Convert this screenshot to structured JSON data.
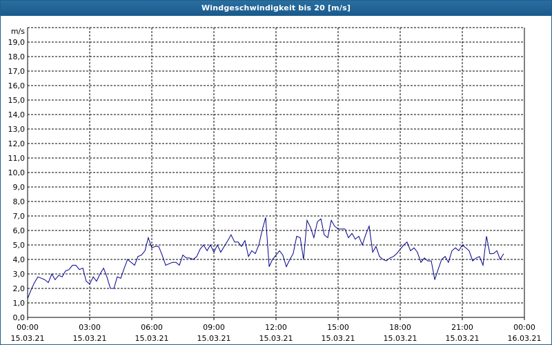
{
  "window": {
    "title": "Windgeschwindigkeit bis 20 [m/s]"
  },
  "colors": {
    "title_bar": "#1f5f8f",
    "series": "#00008b",
    "grid": "#000000"
  },
  "chart_data": {
    "type": "line",
    "title": "Windgeschwindigkeit bis 20 [m/s]",
    "ylabel": "m/s",
    "ylim": [
      0,
      20
    ],
    "y_ticks": [
      "0,0",
      "1,0",
      "2,0",
      "3,0",
      "4,0",
      "5,0",
      "6,0",
      "7,0",
      "8,0",
      "9,0",
      "10,0",
      "11,0",
      "12,0",
      "13,0",
      "14,0",
      "15,0",
      "16,0",
      "17,0",
      "18,0",
      "19,0"
    ],
    "x_ticks": [
      {
        "time": "00:00",
        "date": "15.03.21"
      },
      {
        "time": "03:00",
        "date": "15.03.21"
      },
      {
        "time": "06:00",
        "date": "15.03.21"
      },
      {
        "time": "09:00",
        "date": "15.03.21"
      },
      {
        "time": "12:00",
        "date": "15.03.21"
      },
      {
        "time": "15:00",
        "date": "15.03.21"
      },
      {
        "time": "18:00",
        "date": "15.03.21"
      },
      {
        "time": "21:00",
        "date": "15.03.21"
      },
      {
        "time": "00:00",
        "date": "16.03.21"
      }
    ],
    "grid": true,
    "x_hours": [
      0.0,
      0.17,
      0.33,
      0.5,
      0.67,
      0.83,
      1.0,
      1.17,
      1.33,
      1.5,
      1.67,
      1.83,
      2.0,
      2.17,
      2.33,
      2.5,
      2.67,
      2.83,
      3.0,
      3.17,
      3.33,
      3.5,
      3.67,
      3.83,
      4.0,
      4.17,
      4.33,
      4.5,
      4.67,
      4.83,
      5.0,
      5.17,
      5.33,
      5.5,
      5.67,
      5.83,
      6.0,
      6.17,
      6.33,
      6.5,
      6.67,
      6.83,
      7.0,
      7.17,
      7.33,
      7.5,
      7.67,
      7.83,
      8.0,
      8.17,
      8.33,
      8.5,
      8.67,
      8.83,
      9.0,
      9.17,
      9.33,
      9.5,
      9.67,
      9.83,
      10.0,
      10.17,
      10.33,
      10.5,
      10.67,
      10.83,
      11.0,
      11.17,
      11.33,
      11.5,
      11.67,
      11.83,
      12.0,
      12.17,
      12.33,
      12.5,
      12.67,
      12.83,
      13.0,
      13.17,
      13.33,
      13.5,
      13.67,
      13.83,
      14.0,
      14.17,
      14.33,
      14.5,
      14.67,
      14.83,
      15.0,
      15.17,
      15.33,
      15.5,
      15.67,
      15.83,
      16.0,
      16.17,
      16.33,
      16.5,
      16.67,
      16.83,
      17.0,
      17.17,
      17.33,
      17.5,
      17.67,
      17.83,
      18.0,
      18.17,
      18.33,
      18.5,
      18.67,
      18.83,
      19.0,
      19.17,
      19.33,
      19.5,
      19.67,
      19.83,
      20.0,
      20.17,
      20.33,
      20.5,
      20.67,
      20.83,
      21.0,
      21.17,
      21.33,
      21.5,
      21.67,
      21.83,
      22.0,
      22.17,
      22.33,
      22.5,
      22.67,
      22.83,
      23.0,
      23.17,
      23.33,
      23.5,
      23.67,
      23.83
    ],
    "series": [
      {
        "values": [
          1.3,
          1.9,
          2.4,
          2.8,
          2.7,
          2.6,
          2.4,
          3.0,
          2.6,
          2.9,
          2.8,
          3.2,
          3.3,
          3.6,
          3.6,
          3.3,
          3.4,
          2.5,
          2.3,
          2.8,
          2.5,
          3.0,
          3.4,
          2.8,
          2.0,
          2.0,
          2.8,
          2.7,
          3.4,
          4.0,
          3.8,
          3.6,
          4.2,
          4.3,
          4.6,
          5.5,
          4.8,
          4.9,
          4.9,
          4.3,
          3.6,
          3.7,
          3.8,
          3.8,
          3.6,
          4.3,
          4.1,
          4.1,
          4.0,
          4.2,
          4.7,
          5.0,
          4.6,
          5.0,
          4.5,
          5.0,
          4.5,
          4.9,
          5.3,
          5.7,
          5.2,
          5.2,
          4.9,
          5.3,
          4.2,
          4.6,
          4.4,
          5.0,
          6.0,
          6.9,
          3.5,
          4.0,
          4.3,
          4.6,
          4.3,
          3.5,
          4.0,
          4.4,
          5.6,
          5.5,
          4.0,
          6.7,
          6.2,
          5.5,
          6.6,
          6.8,
          5.7,
          5.5,
          6.7,
          6.3,
          6.1,
          6.1,
          6.1,
          5.5,
          5.8,
          5.4,
          5.6,
          5.0,
          5.7,
          6.3,
          4.5,
          4.9,
          4.2,
          4.0,
          3.9,
          4.1,
          4.2,
          4.4,
          4.7,
          5.0,
          5.2,
          4.6,
          4.8,
          4.5,
          3.8,
          4.1,
          3.9,
          3.9,
          2.6,
          3.3,
          4.0,
          4.2,
          3.8,
          4.6,
          4.8,
          4.6,
          5.0,
          4.8,
          4.6,
          3.9,
          4.1,
          4.2,
          3.6,
          5.6,
          4.4,
          4.4,
          4.6,
          4.0,
          4.4
        ]
      }
    ]
  }
}
